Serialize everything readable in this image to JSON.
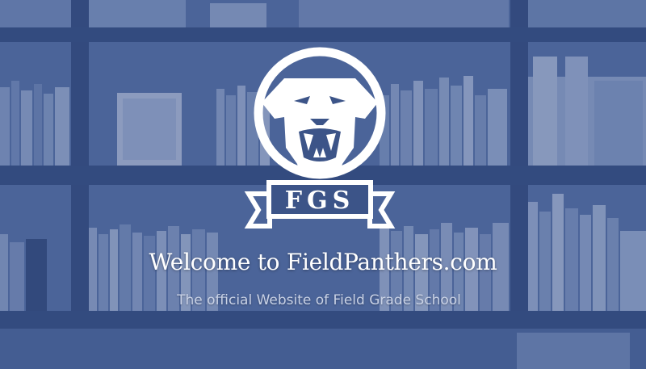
{
  "hero": {
    "logo": {
      "initials": "FGS",
      "icon": "panther-head-icon"
    },
    "headline": "Welcome to FieldPanthers.com",
    "tagline": "The official Website of Field Grade School"
  },
  "colors": {
    "background": "#3c5488",
    "text": "#ffffff",
    "tagline": "#c9d2e6"
  }
}
